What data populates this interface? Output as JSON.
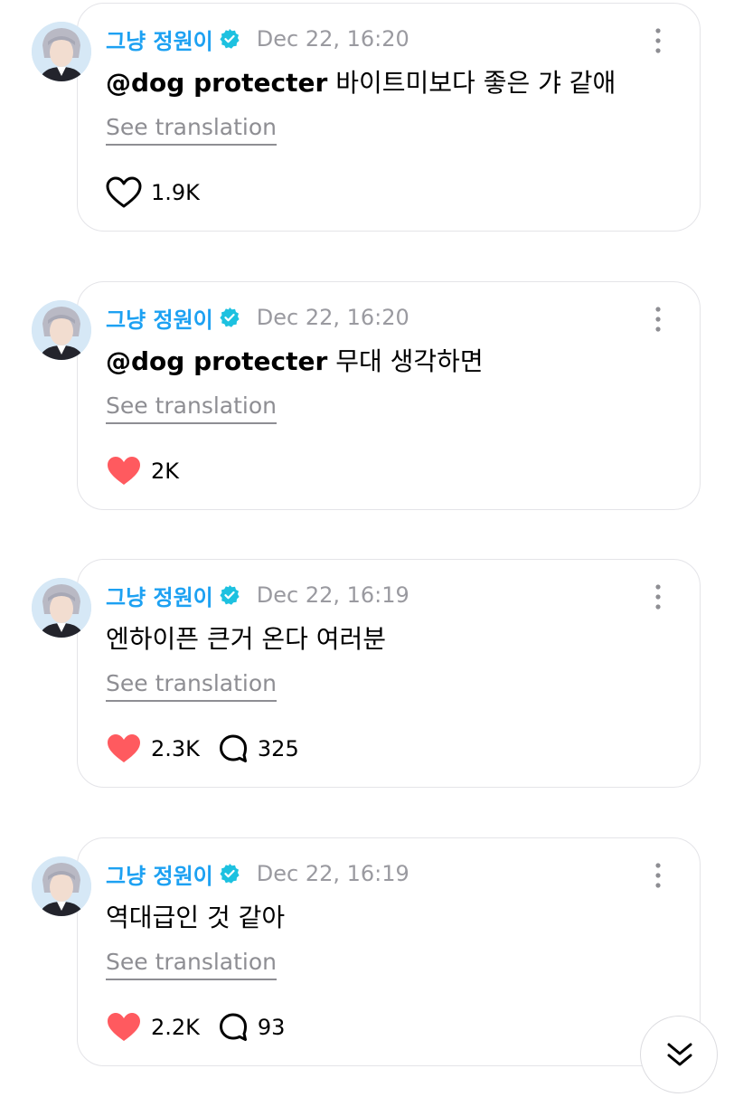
{
  "posts": [
    {
      "author": "그냥 정원이",
      "time": "Dec 22, 16:20",
      "mention": "@dog protecter",
      "text": " 바이트미보다 좋은 갸 같애",
      "translate": "See translation",
      "likes": "1.9K",
      "liked": false,
      "comments": ""
    },
    {
      "author": "그냥 정원이",
      "time": "Dec 22, 16:20",
      "mention": "@dog protecter",
      "text": " 무대 생각하면",
      "translate": "See translation",
      "likes": "2K",
      "liked": true,
      "comments": ""
    },
    {
      "author": "그냥 정원이",
      "time": "Dec 22, 16:19",
      "mention": "",
      "text": "엔하이픈 큰거 온다 여러분",
      "translate": "See translation",
      "likes": "2.3K",
      "liked": true,
      "comments": "325"
    },
    {
      "author": "그냥 정원이",
      "time": "Dec 22, 16:19",
      "mention": "",
      "text": "역대급인 것 같아",
      "translate": "See translation",
      "likes": "2.2K",
      "liked": true,
      "comments": "93"
    }
  ],
  "colors": {
    "author": "#1da1f2",
    "verified": "#1dc1e0",
    "heart_liked": "#ff5a5f",
    "muted": "#9a9aa0"
  },
  "icons": {
    "verified": "verified-badge-icon",
    "more": "more-vertical-icon",
    "like": "heart-icon",
    "comment": "comment-bubble-icon",
    "scroll": "double-chevron-down-icon"
  }
}
